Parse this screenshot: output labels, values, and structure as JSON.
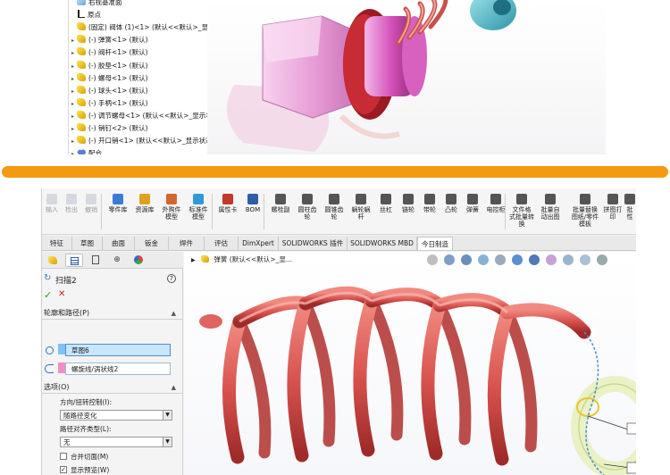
{
  "top": {
    "tree": [
      {
        "label": "右视基准面",
        "arrow": "",
        "icon": "plane-icon"
      },
      {
        "label": "原点",
        "arrow": "",
        "icon": "origin-icon"
      },
      {
        "label": "(固定) 阀体 (1)<1> (默认<<默认>_显示",
        "arrow": "",
        "icon": "part-icon"
      },
      {
        "label": "(-) 弹簧<1> (默认)",
        "arrow": "▸",
        "icon": "part-icon"
      },
      {
        "label": "(-) 阀杆<1> (默认)",
        "arrow": "▸",
        "icon": "part-icon"
      },
      {
        "label": "(-) 胶垫<1> (默认)",
        "arrow": "▸",
        "icon": "part-icon"
      },
      {
        "label": "(-) 螺母<1> (默认)",
        "arrow": "▸",
        "icon": "part-icon"
      },
      {
        "label": "(-) 球头<1> (默认)",
        "arrow": "▸",
        "icon": "part-icon"
      },
      {
        "label": "(-) 手柄<1> (默认)",
        "arrow": "▸",
        "icon": "part-icon"
      },
      {
        "label": "(-) 调节螺母<1> (默认<<默认>_显示状",
        "arrow": "▸",
        "icon": "part-icon"
      },
      {
        "label": "(-) 销钉<2> (默认)",
        "arrow": "▸",
        "icon": "part-icon"
      },
      {
        "label": "(-) 开口销<1> (默认<<默认>_显示状态",
        "arrow": "▸",
        "icon": "part-icon"
      },
      {
        "label": "配合",
        "arrow": "▸",
        "icon": "mates-icon"
      }
    ]
  },
  "toolbar": {
    "buttons": [
      {
        "label": "输入",
        "label2": "",
        "disabled": true,
        "color": "#9aa7b8"
      },
      {
        "label": "检出",
        "label2": "",
        "disabled": true,
        "color": "#9aa7b8"
      },
      {
        "label": "撤销",
        "label2": "",
        "disabled": true,
        "color": "#9aa7b8"
      },
      {
        "label": "零件库",
        "label2": "",
        "disabled": false,
        "color": "#3a7bd5"
      },
      {
        "label": "资源库",
        "label2": "",
        "disabled": false,
        "color": "#e0a21c"
      },
      {
        "label": "外购件",
        "label2": "模型",
        "disabled": false,
        "color": "#d1672c"
      },
      {
        "label": "标准件",
        "label2": "模型",
        "disabled": false,
        "color": "#2f9ad6"
      },
      {
        "label": "属性卡",
        "label2": "",
        "disabled": false,
        "color": "#c0392b"
      },
      {
        "label": "BOM",
        "label2": "",
        "disabled": false,
        "color": "#2e5ea8"
      },
      {
        "label": "螺栓副",
        "label2": "",
        "disabled": false,
        "color": "#555555"
      },
      {
        "label": "圆柱齿",
        "label2": "轮",
        "disabled": false,
        "color": "#555555"
      },
      {
        "label": "圆锥齿",
        "label2": "轮",
        "disabled": false,
        "color": "#555555"
      },
      {
        "label": "蜗轮蜗",
        "label2": "杆",
        "disabled": false,
        "color": "#555555"
      },
      {
        "label": "丝杠",
        "label2": "",
        "disabled": false,
        "color": "#555555"
      },
      {
        "label": "链轮",
        "label2": "",
        "disabled": false,
        "color": "#555555"
      },
      {
        "label": "带轮",
        "label2": "",
        "disabled": false,
        "color": "#555555"
      },
      {
        "label": "凸轮",
        "label2": "",
        "disabled": false,
        "color": "#555555"
      },
      {
        "label": "弹簧",
        "label2": "",
        "disabled": false,
        "color": "#555555"
      },
      {
        "label": "电控柜",
        "label2": "",
        "disabled": false,
        "color": "#555555"
      },
      {
        "label": "文件格",
        "label2": "式批量转换",
        "disabled": false,
        "color": "#555555"
      },
      {
        "label": "批量自",
        "label2": "动出图",
        "disabled": false,
        "color": "#555555"
      },
      {
        "label": "批量替换",
        "label2": "图纸/零件模板",
        "disabled": false,
        "color": "#555555"
      },
      {
        "label": "拼图打",
        "label2": "印",
        "disabled": false,
        "color": "#555555"
      },
      {
        "label": "批",
        "label2": "性",
        "disabled": false,
        "color": "#555555"
      }
    ]
  },
  "tabs": [
    "特征",
    "草图",
    "曲面",
    "钣金",
    "焊件",
    "评估",
    "DimXpert",
    "SOLIDWORKS 插件",
    "SOLIDWORKS MBD",
    "今日制造"
  ],
  "active_tab": "今日制造",
  "property_manager": {
    "title": "扫描2",
    "help": "?",
    "ok": "✓",
    "cancel": "✕",
    "section_profile": "轮廓和路径(P)",
    "profile_value": "草图6",
    "path_value": "螺旋线/涡状线2",
    "section_options": "选项(O)",
    "orientation_label": "方向/扭转控制(I):",
    "orientation_value": "随路径变化",
    "alignment_label": "路径对齐类型(L):",
    "alignment_value": "无",
    "merge_faces": "合并切面(M)",
    "merge_faces_checked": false,
    "show_preview": "显示预览(W)",
    "show_preview_checked": true
  },
  "graphics": {
    "breadcrumb": "弹簧 (默认<<默认>_显..."
  },
  "colors": {
    "divider": "#f39a12",
    "spring": "#d9534f",
    "selection": "#4a90d0"
  }
}
